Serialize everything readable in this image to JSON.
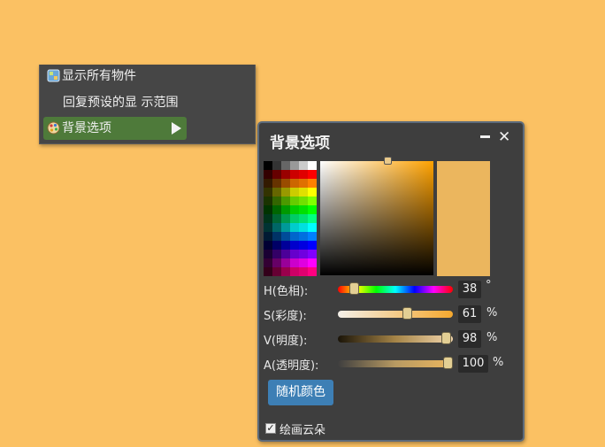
{
  "context_menu": {
    "items": [
      {
        "label": "显示所有物件",
        "icon": "layers-icon"
      },
      {
        "label": "回复预设的显 示范围",
        "icon": ""
      },
      {
        "label": "背景选项",
        "icon": "palette-icon",
        "submenu": true
      }
    ]
  },
  "panel": {
    "title": "背景选项",
    "minimize_icon": "minimize-icon",
    "close_icon": "close-icon",
    "close_glyph": "✕",
    "swatch_color": "#ebb65e",
    "hue": {
      "label": "H(色相):",
      "value": "38",
      "unit": "°",
      "fraction": 0.106
    },
    "saturation": {
      "label": "S(彩度):",
      "value": "61",
      "unit": "%",
      "fraction": 0.61
    },
    "brightness": {
      "label": "V(明度):",
      "value": "98",
      "unit": "%",
      "fraction": 0.98
    },
    "alpha": {
      "label": "A(透明度):",
      "value": "100",
      "unit": "%",
      "fraction": 1.0
    },
    "random_button": "随机颜色",
    "draw_clouds": {
      "label": "绘画云朵",
      "checked": true,
      "check_glyph": "✓"
    }
  }
}
